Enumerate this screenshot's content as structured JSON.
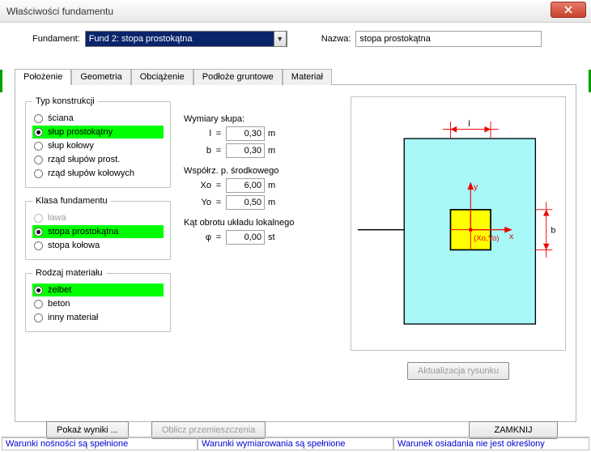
{
  "window": {
    "title": "Właściwości fundamentu"
  },
  "top": {
    "fund_label": "Fundament:",
    "fund_value": "Fund 2: stopa prostokątna",
    "name_label": "Nazwa:",
    "name_value": "stopa prostokątna"
  },
  "tabs": [
    "Położenie",
    "Geometria",
    "Obciążenie",
    "Podłoże gruntowe",
    "Materiał"
  ],
  "groups": {
    "constr": {
      "legend": "Typ konstrukcji",
      "items": [
        "ściana",
        "słup prostokątny",
        "słup kołowy",
        "rząd słupów prost.",
        "rząd słupów kołowych"
      ],
      "selected": 1
    },
    "klasa": {
      "legend": "Klasa fundamentu",
      "items": [
        "ława",
        "stopa prostokątna",
        "stopa kołowa"
      ],
      "disabled": [
        0
      ],
      "selected": 1
    },
    "material": {
      "legend": "Rodzaj materiału",
      "items": [
        "żelbet",
        "beton",
        "inny materiał"
      ],
      "selected": 0
    }
  },
  "mid": {
    "dims_label": "Wymiary słupa:",
    "l_label": "l",
    "l_value": "0,30",
    "unit_m": "m",
    "b_label": "b",
    "b_value": "0,30",
    "coord_label": "Współrz. p. środkowego",
    "xo_label": "Xo",
    "xo_value": "6,00",
    "yo_label": "Yo",
    "yo_value": "0,50",
    "rot_label": "Kąt obrotu układu lokalnego",
    "phi_label": "φ",
    "phi_value": "0,00",
    "unit_st": "st"
  },
  "diagram": {
    "l_dim": "l",
    "b_dim": "b",
    "x_axis": "x",
    "y_axis": "y",
    "center": "(Xo,Yo)"
  },
  "buttons": {
    "update": "Aktualizacja rysunku",
    "results": "Pokaż wyniki ...",
    "calc": "Oblicz przemieszczenia",
    "close": "ZAMKNIJ"
  },
  "status": {
    "a": "Warunki nośności są spełnione",
    "b": "Warunki wymiarowania są spełnione",
    "c": "Warunek osiadania nie jest określony"
  }
}
